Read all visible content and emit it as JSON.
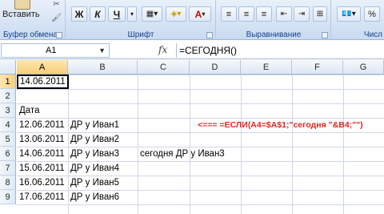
{
  "ribbon": {
    "clipboard": {
      "paste_label": "Вставить",
      "group_label": "Буфер обмена"
    },
    "font": {
      "group_label": "Шрифт",
      "bold_label": "Ж",
      "italic_label": "К",
      "underline_label": "Ч",
      "font_color_label": "А"
    },
    "alignment": {
      "group_label": "Выравнивание"
    },
    "number": {
      "group_label": "Числ"
    }
  },
  "formula_bar": {
    "name_box": "A1",
    "fx_label": "fx",
    "formula": "=СЕГОДНЯ()"
  },
  "grid": {
    "columns": [
      "A",
      "B",
      "C",
      "D",
      "E",
      "F",
      "G"
    ],
    "rows": [
      "1",
      "2",
      "3",
      "4",
      "5",
      "6",
      "7",
      "8",
      "9"
    ],
    "cells": {
      "A1": "14.06.2011",
      "A3": "Дата",
      "A4": "12.06.2011",
      "B4": "ДР у Иван1",
      "A5": "13.06.2011",
      "B5": "ДР у Иван2",
      "A6": "14.06.2011",
      "B6": "ДР у Иван3",
      "C6": "сегодня ДР у Иван3",
      "A7": "15.06.2011",
      "B7": "ДР у Иван4",
      "A8": "16.06.2011",
      "B8": "ДР у Иван5",
      "A9": "17.06.2011",
      "B9": "ДР у Иван6"
    },
    "annotation": "<=== =ЕСЛИ(A4=$A$1;\"сегодня \"&B4;\"\")"
  },
  "colors": {
    "annotation": "#e0271f",
    "selection": "#f8cf78",
    "ribbon_label": "#15428b"
  }
}
